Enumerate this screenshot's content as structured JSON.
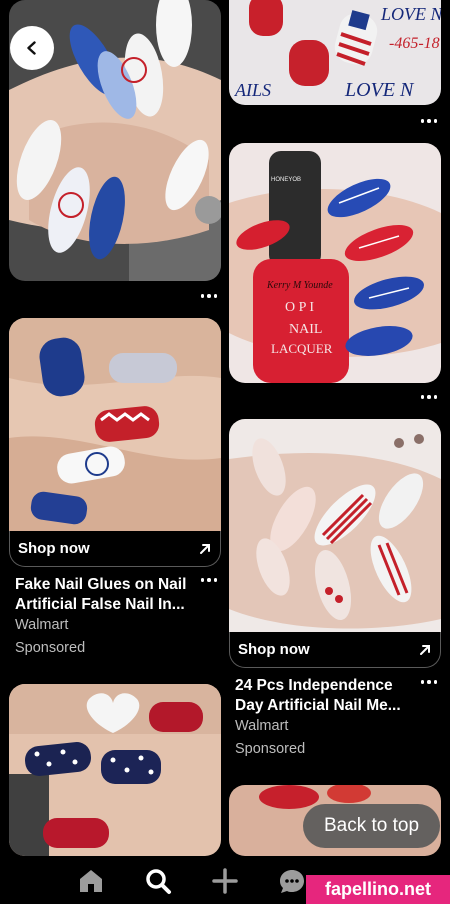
{
  "nav": {
    "back_icon": "chevron-left-icon"
  },
  "pins": {
    "left": [
      {
        "kind": "image",
        "description_colors": [
          "#e7c9b7",
          "#1d3f8f",
          "#c4202a",
          "#f4f4f4"
        ]
      },
      {
        "kind": "product",
        "shop_label": "Shop now",
        "title": "Fake Nail Glues on Nail Artificial False Nail In...",
        "seller": "Walmart",
        "status": "Sponsored"
      },
      {
        "kind": "image"
      }
    ],
    "right": [
      {
        "kind": "image",
        "overlay_text_1": "LOVE N",
        "overlay_text_2": "-465-18",
        "overlay_text_3": "AILS",
        "overlay_text_4": "LOVE N"
      },
      {
        "kind": "image",
        "bottle_text_1": "Kerry M Younde",
        "bottle_text_2": "O P I",
        "bottle_text_3": "NAIL",
        "bottle_text_4": "LACQUER",
        "corner_text": "HONEYOB"
      },
      {
        "kind": "product",
        "shop_label": "Shop now",
        "title": "24 Pcs Independence Day Artificial Nail Me...",
        "seller": "Walmart",
        "status": "Sponsored"
      },
      {
        "kind": "image"
      }
    ]
  },
  "back_to_top": "Back to top",
  "bottom_nav": {
    "items": [
      "home-icon",
      "search-icon",
      "plus-icon",
      "chat-icon"
    ]
  },
  "watermark": "fapellino.net",
  "colors": {
    "accent": "#e6267d",
    "background": "#000000"
  }
}
